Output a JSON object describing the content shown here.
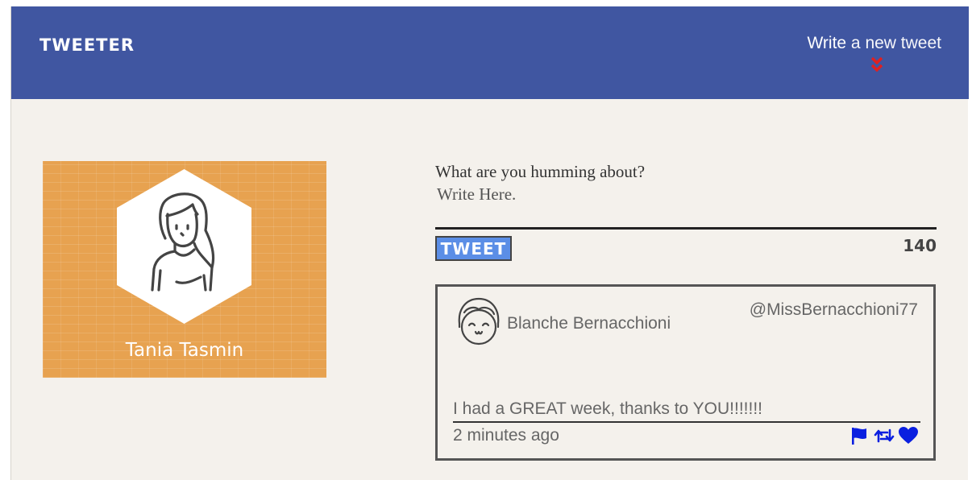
{
  "header": {
    "brand": "TWEETER",
    "compose_toggle": {
      "strong": "Write",
      "light": " a new tweet",
      "icon": "double-chevron-down-icon",
      "icon_color": "#e02020"
    },
    "background": "#4056a1"
  },
  "profile": {
    "name": "Tania Tasmin",
    "avatar_icon": "woman-avatar-icon",
    "background": "#e7a250"
  },
  "compose": {
    "label": "What are you humming about?",
    "placeholder": "Write Here.",
    "button_label": "TWEET",
    "button_color": "#5b8ee6",
    "counter": "140"
  },
  "tweets": [
    {
      "author": "Blanche Bernacchioni",
      "handle": "@MissBernacchioni77",
      "avatar_icon": "girl-smiling-avatar-icon",
      "text": "I had a GREAT week, thanks to YOU!!!!!!!",
      "time": "2 minutes ago",
      "actions": [
        "flag-icon",
        "retweet-icon",
        "heart-icon"
      ],
      "action_color": "#0a1fe0"
    }
  ]
}
